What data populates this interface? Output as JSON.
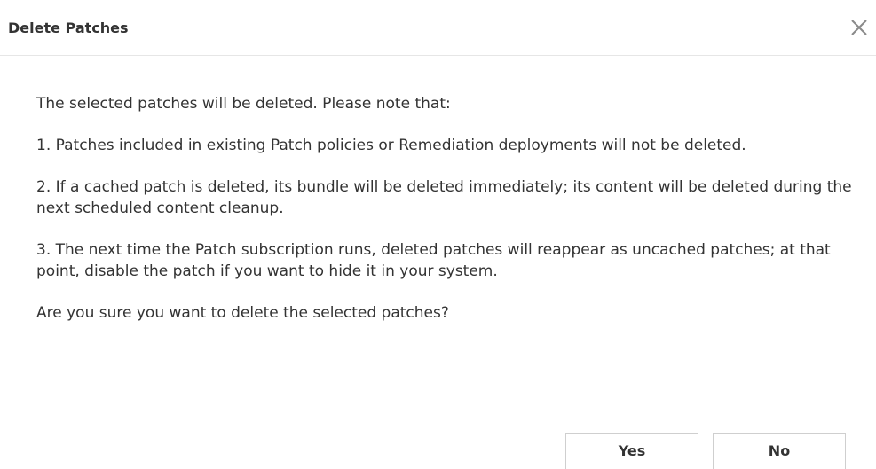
{
  "dialog": {
    "title": "Delete Patches",
    "close_icon": "close-icon",
    "paragraphs": [
      "The selected patches will be deleted. Please note that:",
      "1. Patches included in existing Patch policies or Remediation deployments will not be deleted.",
      "2. If a cached patch is deleted, its bundle will be deleted immediately; its content will be deleted during the next scheduled content cleanup.",
      "3. The next time the Patch subscription runs, deleted patches will reappear as uncached patches; at that point, disable the patch if you want to hide it in your system.",
      "Are you sure you want to delete the selected patches?"
    ],
    "buttons": {
      "yes_label": "Yes",
      "no_label": "No"
    }
  }
}
